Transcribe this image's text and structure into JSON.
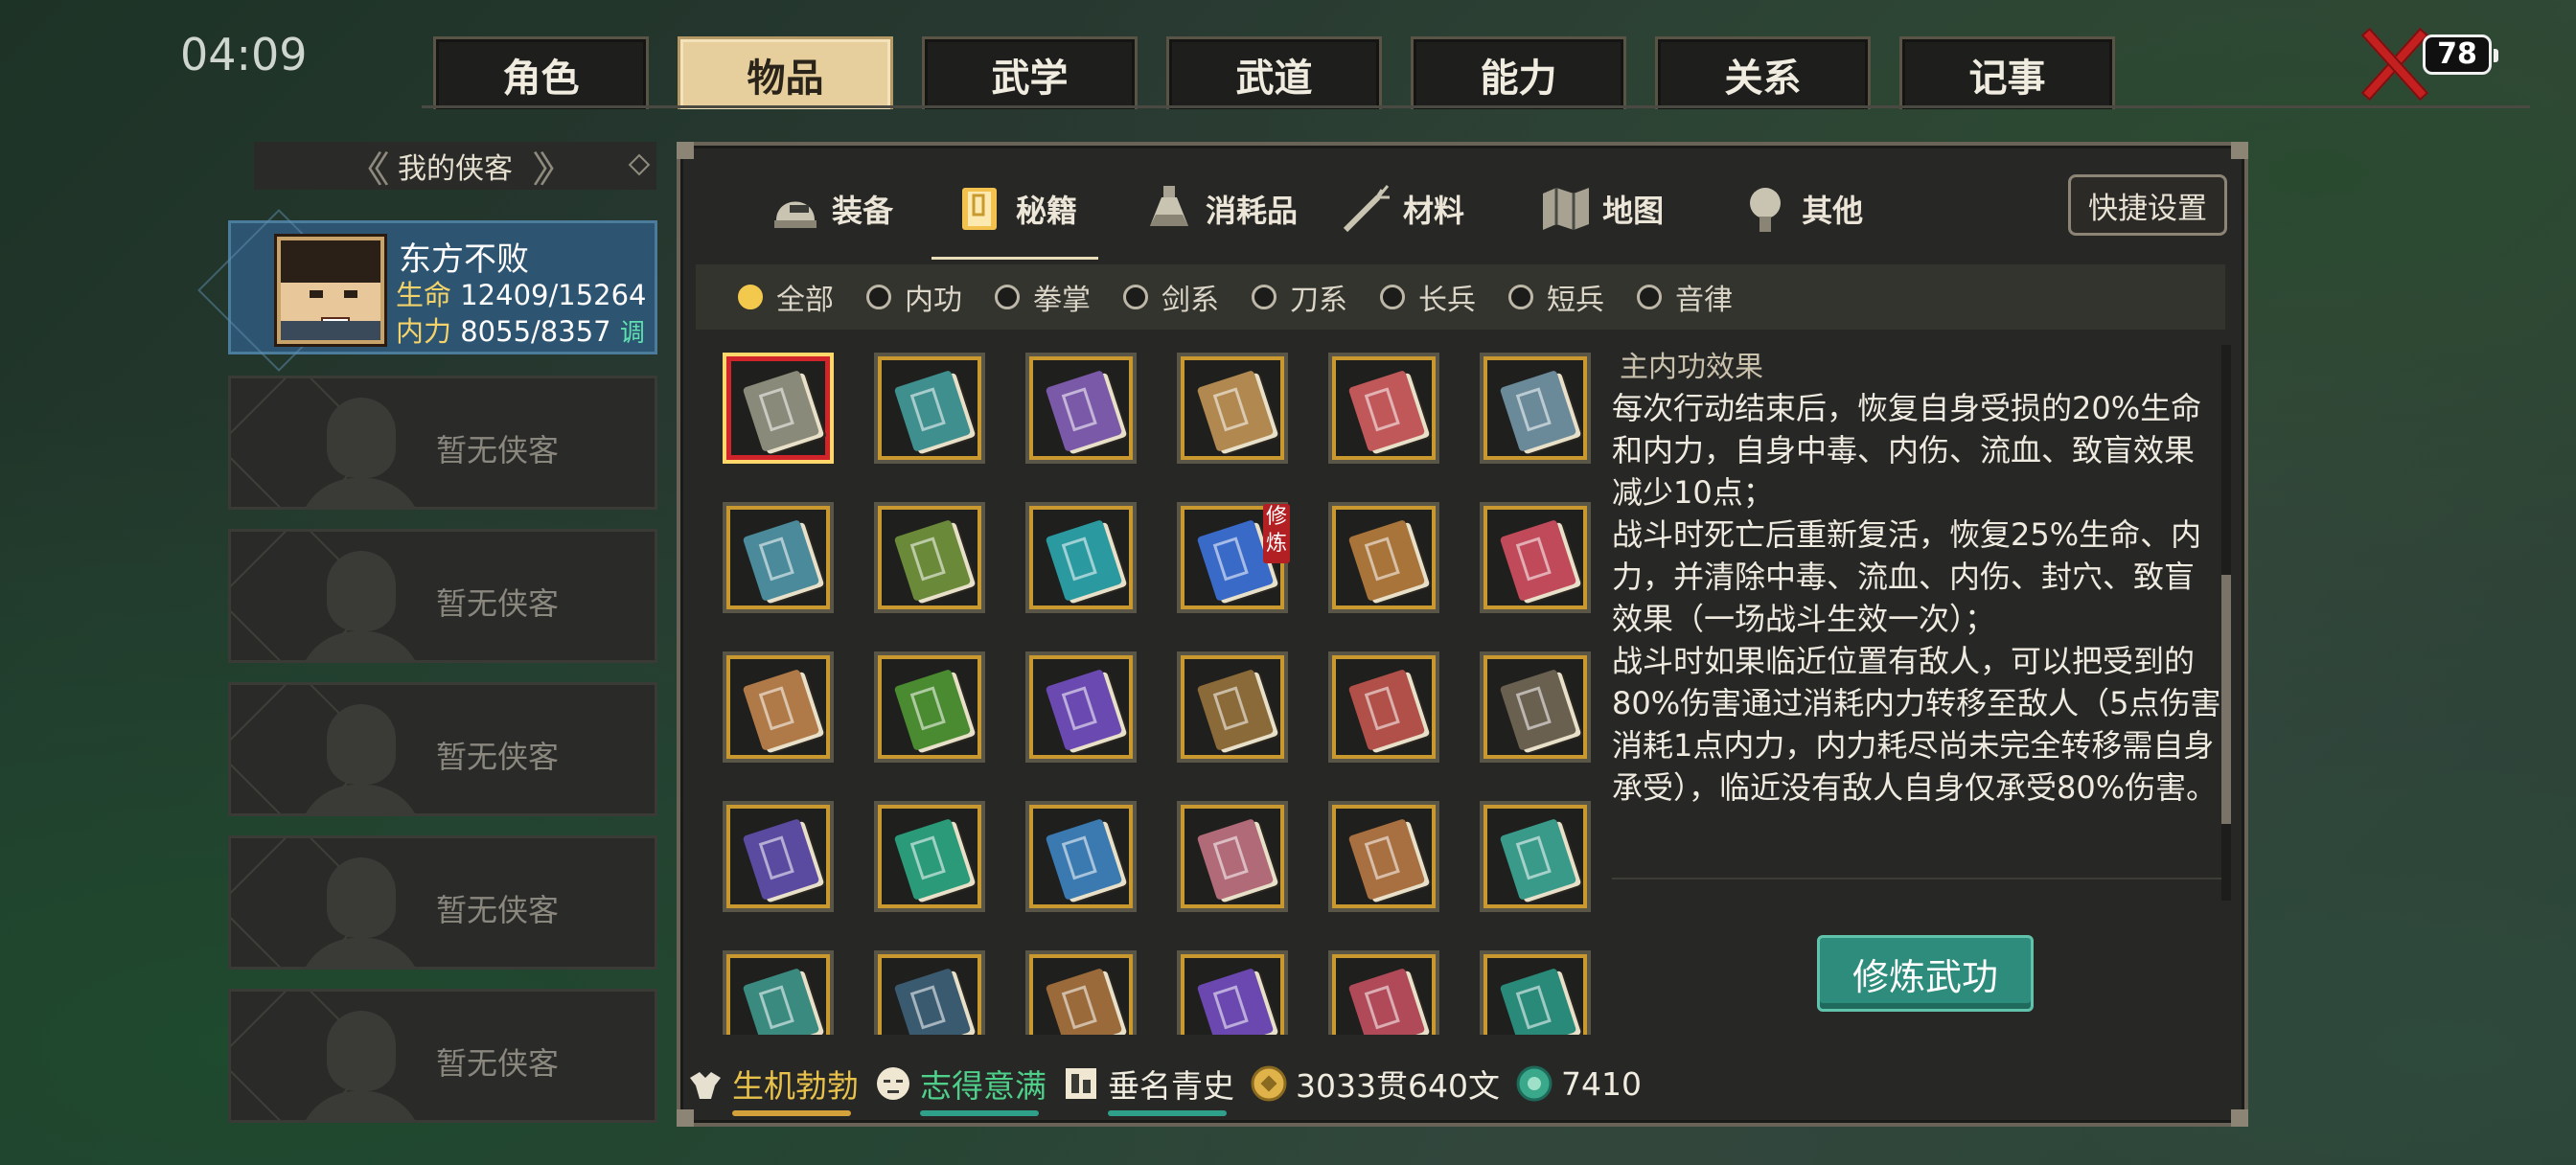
{
  "status": {
    "time": "04:09",
    "battery": "78"
  },
  "top_tabs": [
    {
      "label": "角色",
      "active": false
    },
    {
      "label": "物品",
      "active": true
    },
    {
      "label": "武学",
      "active": false
    },
    {
      "label": "武道",
      "active": false
    },
    {
      "label": "能力",
      "active": false
    },
    {
      "label": "关系",
      "active": false
    },
    {
      "label": "记事",
      "active": false
    }
  ],
  "sidebar": {
    "title": "我的侠客",
    "character": {
      "name": "东方不败",
      "hp_label": "生命",
      "hp": "12409/15264",
      "mp_label": "内力",
      "mp": "8055/8357",
      "adjust_label": "调"
    },
    "empty_slot_label": "暂无侠客",
    "empty_slots": 5
  },
  "category_tabs": [
    {
      "label": "装备",
      "icon": "helmet-icon",
      "active": false
    },
    {
      "label": "秘籍",
      "icon": "book-icon",
      "active": true
    },
    {
      "label": "消耗品",
      "icon": "potion-icon",
      "active": false
    },
    {
      "label": "材料",
      "icon": "herb-icon",
      "active": false
    },
    {
      "label": "地图",
      "icon": "map-icon",
      "active": false
    },
    {
      "label": "其他",
      "icon": "misc-icon",
      "active": false
    }
  ],
  "quick_settings_label": "快捷设置",
  "filters": [
    {
      "label": "全部",
      "on": true
    },
    {
      "label": "内功",
      "on": false
    },
    {
      "label": "拳掌",
      "on": false
    },
    {
      "label": "剑系",
      "on": false
    },
    {
      "label": "刀系",
      "on": false
    },
    {
      "label": "长兵",
      "on": false
    },
    {
      "label": "短兵",
      "on": false
    },
    {
      "label": "音律",
      "on": false
    }
  ],
  "items": [
    {
      "color": "#8a8a7a",
      "selected": true
    },
    {
      "color": "#3f8f8f"
    },
    {
      "color": "#7a5aa8"
    },
    {
      "color": "#b08850"
    },
    {
      "color": "#c0585a"
    },
    {
      "color": "#6a8a9a"
    },
    {
      "color": "#4a8a9a"
    },
    {
      "color": "#6a8a3a"
    },
    {
      "color": "#2a9aa0"
    },
    {
      "color": "#3a6ac8",
      "tag": "修炼"
    },
    {
      "color": "#a8743a"
    },
    {
      "color": "#c04a5a"
    },
    {
      "color": "#b07a48"
    },
    {
      "color": "#4a8a30"
    },
    {
      "color": "#6a4ab0"
    },
    {
      "color": "#8a6a38"
    },
    {
      "color": "#b05048"
    },
    {
      "color": "#6a6050"
    },
    {
      "color": "#5a4aa0"
    },
    {
      "color": "#2a9a78"
    },
    {
      "color": "#3a7ab0"
    },
    {
      "color": "#b06a78"
    },
    {
      "color": "#a87040"
    },
    {
      "color": "#3a9a8a"
    },
    {
      "color": "#3a8a80"
    },
    {
      "color": "#3a5a70"
    },
    {
      "color": "#9a6a3a"
    },
    {
      "color": "#6a48b0"
    },
    {
      "color": "#b04a58"
    },
    {
      "color": "#2a8a7a"
    }
  ],
  "description": {
    "heading": "主内功效果",
    "paragraphs": [
      "每次行动结束后，恢复自身受损的20%生命和内力，自身中毒、内伤、流血、致盲效果减少10点；",
      "战斗时死亡后重新复活，恢复25%生命、内力，并清除中毒、流血、内伤、封穴、致盲效果（一场战斗生效一次）；",
      "战斗时如果临近位置有敌人，可以把受到的80%伤害通过消耗内力转移至敌人（5点伤害消耗1点内力，内力耗尽尚未完全转移需自身承受），临近没有敌人自身仅承受80%伤害。"
    ],
    "action_label": "修炼武功"
  },
  "bottom_status": [
    {
      "label": "生机勃勃",
      "icon": "strength-icon",
      "color": "#e8c24a",
      "bar": "#d4a23a"
    },
    {
      "label": "志得意满",
      "icon": "mood-icon",
      "color": "#4fd08a",
      "bar": "#2fa08a"
    },
    {
      "label": "垂名青史",
      "icon": "scroll-icon",
      "color": "#f0ece0",
      "bar": "#2fa08a"
    },
    {
      "label": "3033贯640文",
      "icon": "coin-icon",
      "color": "#f0ece0"
    },
    {
      "label": "7410",
      "icon": "jade-icon",
      "color": "#f0ece0"
    }
  ]
}
